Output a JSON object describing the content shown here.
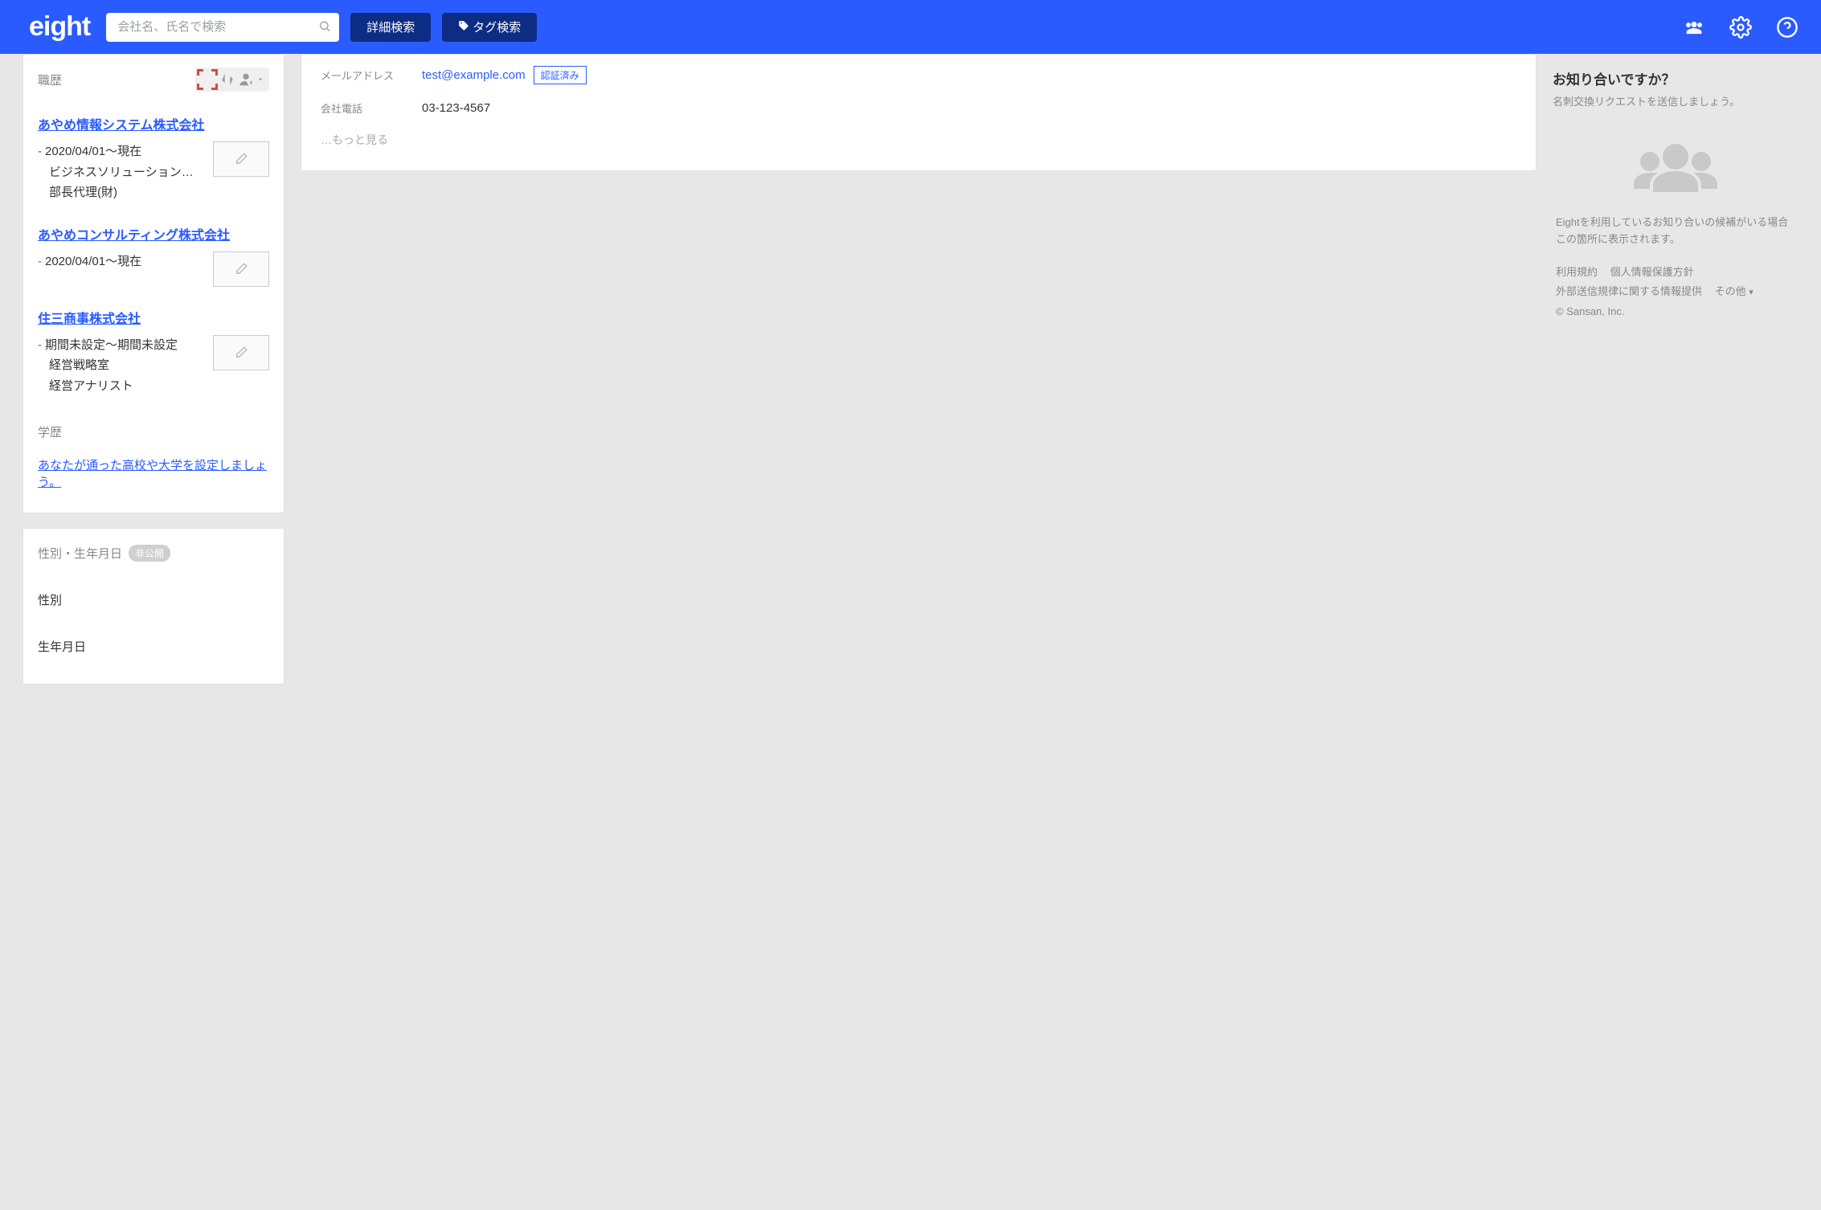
{
  "header": {
    "logo": "eight",
    "search_placeholder": "会社名、氏名で検索",
    "detail_search": "詳細検索",
    "tag_search": "タグ検索"
  },
  "left": {
    "career_label": "職歴",
    "items": [
      {
        "company": "あやめ情報システム株式会社",
        "period": "2020/04/01〜現在",
        "line2": "ビジネスソリューション…",
        "line3": "部長代理(財)"
      },
      {
        "company": "あやめコンサルティング株式会社",
        "period": "2020/04/01〜現在",
        "line2": "",
        "line3": ""
      },
      {
        "company": "住三商事株式会社",
        "period": "期間未設定〜期間未設定",
        "line2": "経営戦略室",
        "line3": "経営アナリスト"
      }
    ],
    "edu_label": "学歴",
    "edu_link": "あなたが通った高校や大学を設定しましょう。",
    "gb_label": "性別・生年月日",
    "private_badge": "非公開",
    "gender_label": "性別",
    "birth_label": "生年月日"
  },
  "contact": {
    "email_label": "メールアドレス",
    "email_value": "test@example.com",
    "verified": "認証済み",
    "phone_label": "会社電話",
    "phone_value": "03-123-4567",
    "more": "…もっと見る"
  },
  "right": {
    "title": "お知り合いですか？",
    "sub": "名刺交換リクエストを送信しましょう。",
    "desc": "Eightを利用しているお知り合いの候補がいる場合この箇所に表示されます。",
    "link_tos": "利用規約",
    "link_privacy": "個人情報保護方針",
    "link_ext": "外部送信規律に関する情報提供",
    "link_other": "その他",
    "copyright": "© Sansan, Inc."
  }
}
